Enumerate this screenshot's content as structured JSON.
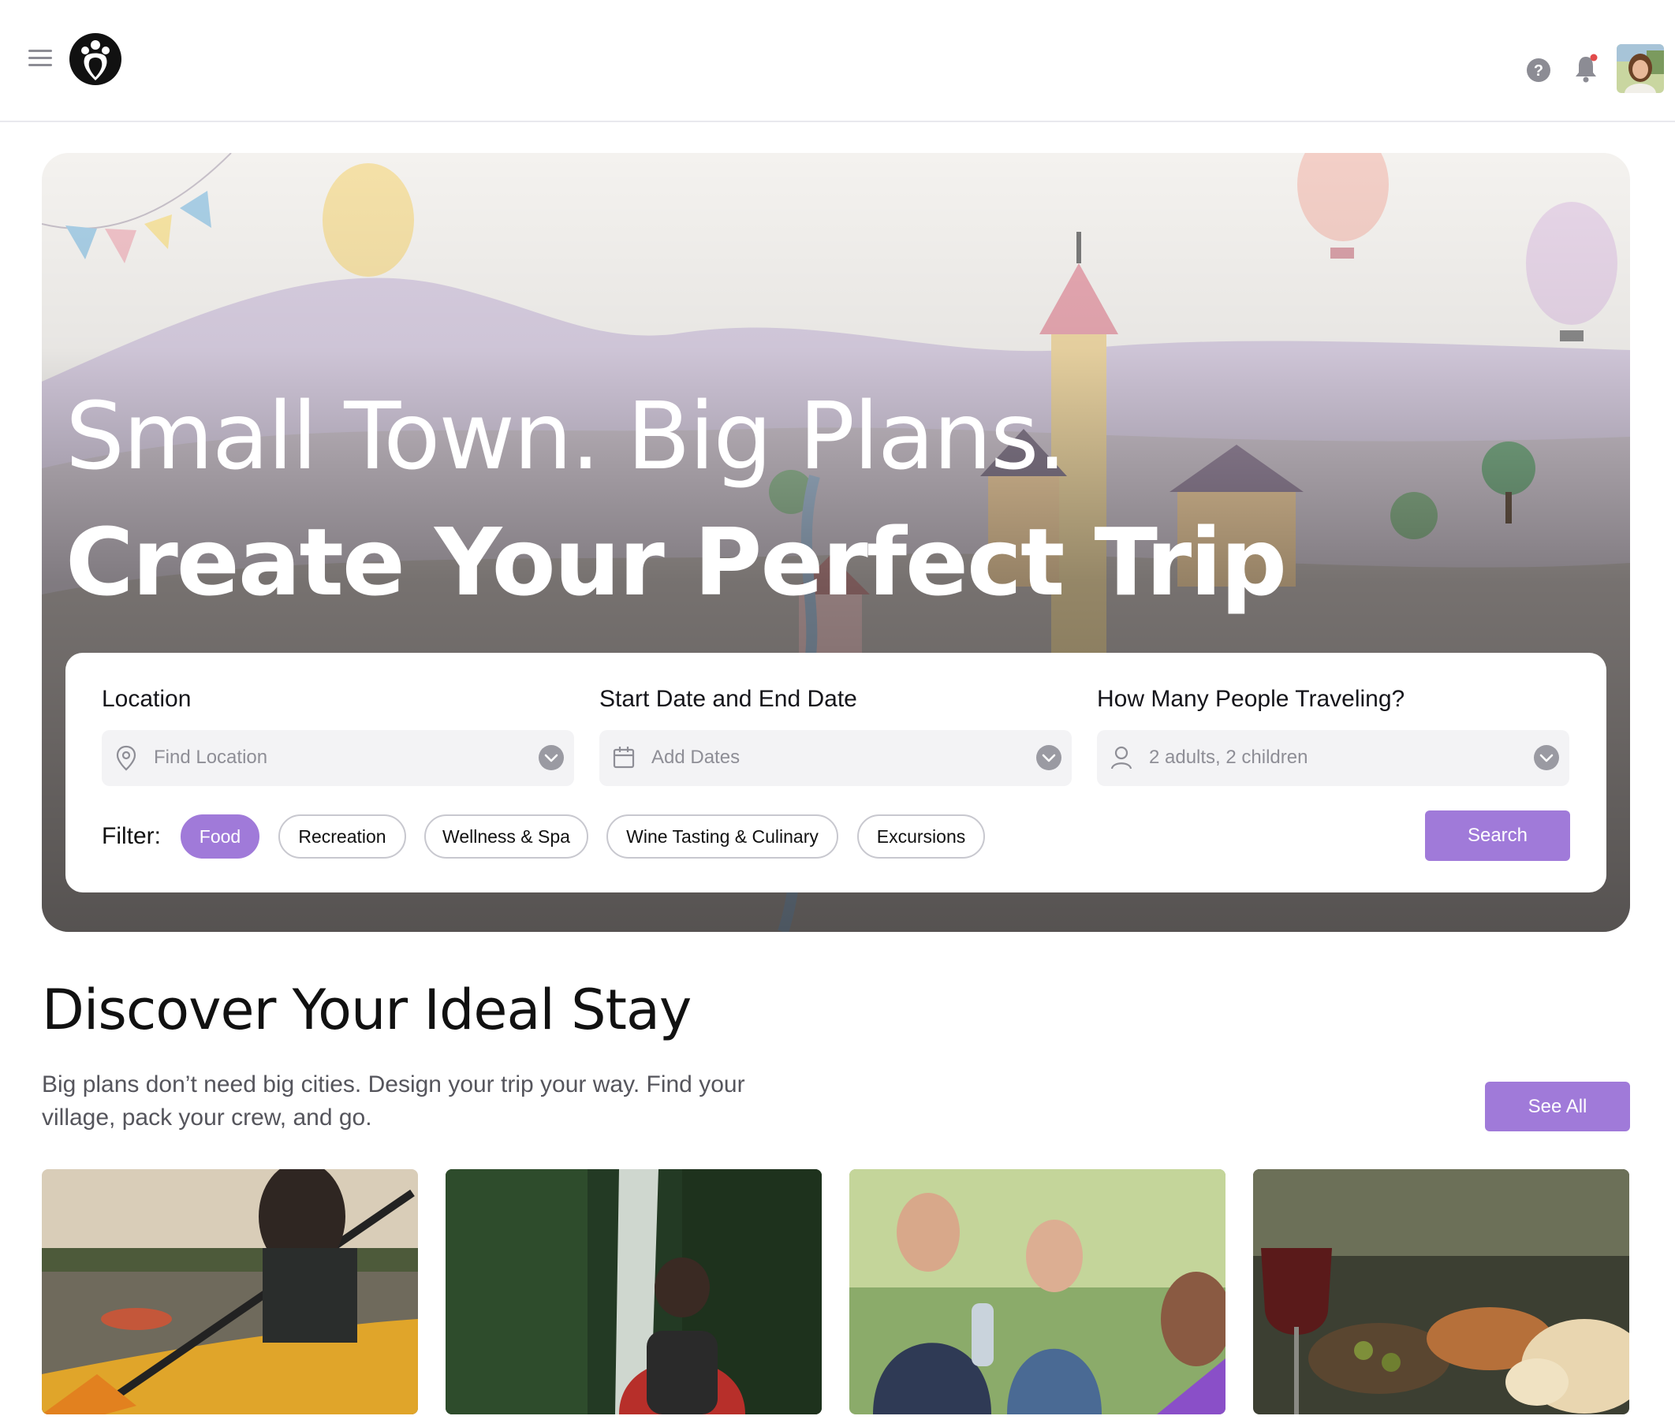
{
  "header": {
    "menu_icon": "hamburger-menu-icon",
    "logo_icon": "brand-logo-icon",
    "help_icon": "question-circle-icon",
    "notification_icon": "bell-icon",
    "avatar": "user-avatar"
  },
  "hero": {
    "title_line1": "Small Town. Big Plans.",
    "title_line2": "Create Your Perfect Trip"
  },
  "search": {
    "location": {
      "label": "Location",
      "placeholder": "Find Location",
      "icon": "map-pin-icon"
    },
    "dates": {
      "label": "Start Date and End Date",
      "placeholder": "Add Dates",
      "icon": "calendar-icon"
    },
    "travelers": {
      "label": "How Many People Traveling?",
      "value": "2 adults, 2 children",
      "icon": "user-icon"
    },
    "filter_label": "Filter:",
    "filters": [
      {
        "label": "Food",
        "active": true
      },
      {
        "label": "Recreation",
        "active": false
      },
      {
        "label": "Wellness & Spa",
        "active": false
      },
      {
        "label": "Wine Tasting & Culinary",
        "active": false
      },
      {
        "label": "Excursions",
        "active": false
      }
    ],
    "search_button": "Search"
  },
  "discover": {
    "title": "Discover Your Ideal Stay",
    "description": "Big plans don’t need big cities. Design your trip your way. Find your village, pack your crew, and go.",
    "see_all_button": "See All",
    "cards": [
      {
        "name": "kayaking-photo"
      },
      {
        "name": "waterfall-hike-photo"
      },
      {
        "name": "friends-outdoors-photo"
      },
      {
        "name": "wine-and-food-photo"
      }
    ]
  },
  "colors": {
    "accent": "#a07ad9",
    "text": "#111111",
    "muted": "#8e8e96",
    "field_bg": "#f3f3f5"
  }
}
